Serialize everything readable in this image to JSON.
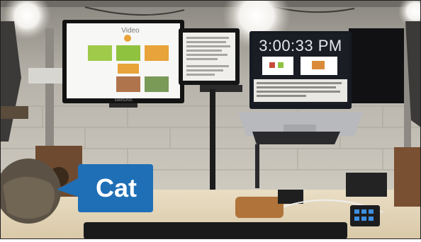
{
  "callout": {
    "label": "Cat",
    "color": "#1f6fb6"
  },
  "left_monitor": {
    "title": "Video",
    "brand": "SAMSUNG"
  },
  "right_monitor": {
    "clock": "3:00:33 PM"
  },
  "colors": {
    "wall": "#c9c6bd",
    "desk": "#e6d9be",
    "screen_dark": "#1a1d24",
    "tile_green": "#8fc23f",
    "tile_orange": "#e8a33a"
  }
}
